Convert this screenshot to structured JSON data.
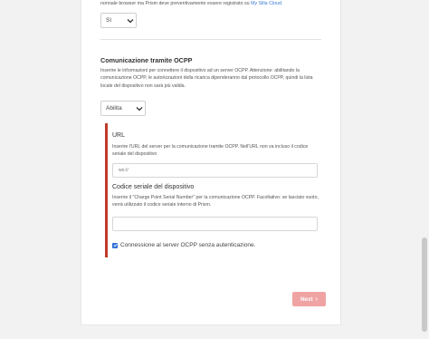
{
  "top": {
    "text_prefix": "nonnale browser ma Prism deve preventivamente essere registrato su",
    "link": "My Silla Cloud.",
    "select_value": "Sì"
  },
  "ocpp": {
    "title": "Comunicazione tramite OCPP",
    "description": "Inserire le informazioni per connettere il dispositivo ad un server OCPP. Attenzione: abilitando la comunicazione OCPP, le autorizzazioni della ricarica dipenderanno dal protocollo OCPP, quindi la lista locale del dispositivo non sarà più valida.",
    "select_value": "Abilita"
  },
  "url": {
    "title": "URL",
    "description": "Inserire l'URL del server per la comunicazione tramite OCPP. Nell'URL non va incluso il codice seriale del dispositivo",
    "placeholder": "ws://"
  },
  "serial": {
    "title": "Codice seriale del dispositivo",
    "description": "Inserire il \"Charge Point Serial Number\" per la comunicazione OCPP. Facoltativo: se lasciato vuoto, verrà utilizzato il codice seriale interno di Prism.",
    "placeholder": ""
  },
  "auth": {
    "label": "Connessione al server OCPP senza autenticazione.",
    "checked": true
  },
  "next": {
    "label": "Next"
  },
  "colors": {
    "accent_red": "#c0392b",
    "button_disabled": "#f0a3a3",
    "checkbox_blue": "#2e6fd6"
  }
}
